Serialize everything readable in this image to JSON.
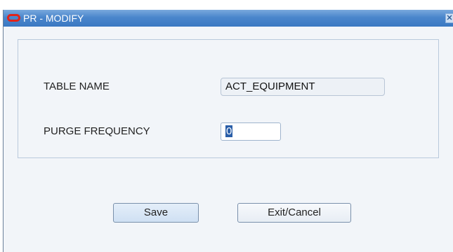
{
  "window": {
    "title": "PR - MODIFY",
    "close_glyph": "✕"
  },
  "form": {
    "table_name_label": "TABLE NAME",
    "table_name_value": "ACT_EQUIPMENT",
    "purge_frequency_label": "PURGE FREQUENCY",
    "purge_frequency_value": "0"
  },
  "buttons": {
    "save_label": "Save",
    "exit_label": "Exit/Cancel"
  },
  "icons": {
    "app_icon": "oracle-logo-icon",
    "close_icon": "close-icon"
  },
  "colors": {
    "titlebar": "#3a78c2",
    "oracle_red": "#e2231a",
    "background": "#f2f5f9"
  }
}
